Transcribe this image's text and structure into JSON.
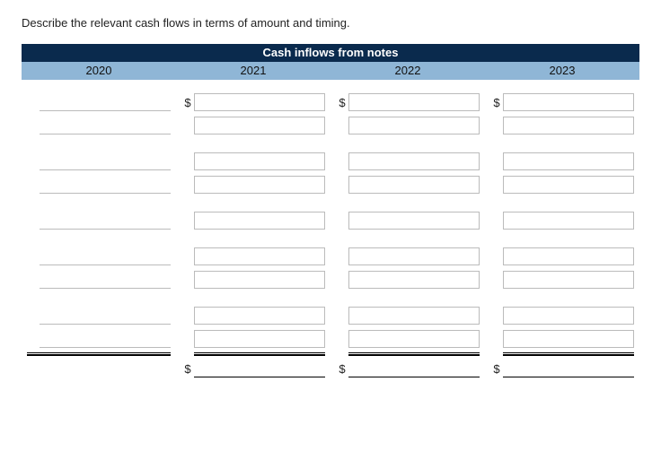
{
  "prompt": "Describe the relevant cash flows in terms of amount and timing.",
  "banner": "Cash inflows from notes",
  "years": [
    "2020",
    "2021",
    "2022",
    "2023"
  ],
  "currency": "$",
  "groups": [
    2,
    2,
    1,
    2,
    2
  ],
  "columns": [
    {
      "year": "2020",
      "has_dollar": false,
      "border_style": "underline"
    },
    {
      "year": "2021",
      "has_dollar": true,
      "border_style": "box"
    },
    {
      "year": "2022",
      "has_dollar": true,
      "border_style": "box"
    },
    {
      "year": "2023",
      "has_dollar": true,
      "border_style": "box"
    }
  ]
}
